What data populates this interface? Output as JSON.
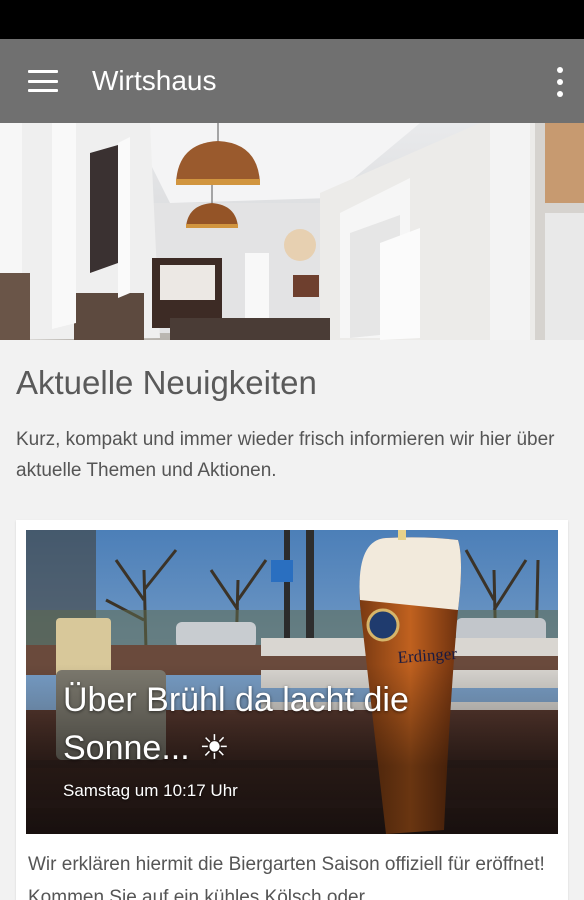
{
  "app_bar": {
    "title": "Wirtshaus",
    "menu_icon": "hamburger-menu-icon",
    "overflow_icon": "more-vert-icon",
    "background": "#707070"
  },
  "news": {
    "heading": "Aktuelle Neuigkeiten",
    "intro": "Kurz, kompakt und immer wieder frisch informieren wir hier über aktuelle Themen und Aktionen."
  },
  "post": {
    "title": "Über Brühl da lacht die Sonne... ☀",
    "date": "Samstag um 10:17 Uhr",
    "text": "Wir erklären hiermit die Biergarten Saison offiziell für eröffnet! Kommen Sie auf ein kühles Kölsch oder",
    "glass_brand": "Erdinger"
  }
}
